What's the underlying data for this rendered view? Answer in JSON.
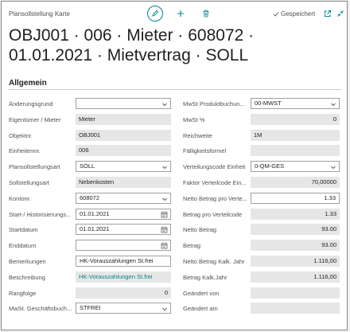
{
  "header": {
    "breadcrumb": "Plansollstellung Karte",
    "saved_label": "Gespeichert",
    "title": "OBJ001 · 006 · Mieter · 608072 · 01.01.2021 · Mietvertrag · SOLL"
  },
  "section": {
    "title": "Allgemein"
  },
  "left_fields": [
    {
      "label": "Änderungsgrund",
      "value": "",
      "type": "select"
    },
    {
      "label": "Eigentümer / Mieter",
      "value": "Mieter",
      "type": "readonly"
    },
    {
      "label": "Objektnr.",
      "value": "OBJ001",
      "type": "readonly"
    },
    {
      "label": "Einheitennr.",
      "value": "006",
      "type": "readonly"
    },
    {
      "label": "Plansollstellungsart",
      "value": "SOLL",
      "type": "select"
    },
    {
      "label": "Sollstellungsart",
      "value": "Nebenkosten",
      "type": "readonly"
    },
    {
      "label": "Kontonr.",
      "value": "608072",
      "type": "select"
    },
    {
      "label": "Start-/ Historisierungs...",
      "value": "01.01.2021",
      "type": "date"
    },
    {
      "label": "Startdatum",
      "value": "01.01.2021",
      "type": "date"
    },
    {
      "label": "Enddatum",
      "value": "",
      "type": "date"
    },
    {
      "label": "Bemerkungen",
      "value": "HK-Vorauszahlungen St.frei",
      "type": "input"
    },
    {
      "label": "Beschreibung",
      "value": "HK-Vorauszahlungen St.frei",
      "type": "readonly-link"
    },
    {
      "label": "Rangfolge",
      "value": "0",
      "type": "readonly-num"
    },
    {
      "label": "MwSt. Geschäftsbuch...",
      "value": "STFREI",
      "type": "select"
    }
  ],
  "right_fields": [
    {
      "label": "MwSt Produktbuchun...",
      "value": "00-MWST",
      "type": "select"
    },
    {
      "label": "MwSt %",
      "value": "0",
      "type": "readonly-num"
    },
    {
      "label": "Reichweite",
      "value": "1M",
      "type": "readonly"
    },
    {
      "label": "Fälligkeitsformel",
      "value": "",
      "type": "readonly"
    },
    {
      "label": "Verteilungscode Einheit",
      "value": "0-QM-GES",
      "type": "select"
    },
    {
      "label": "Faktor Verteilcode Ein...",
      "value": "70,00000",
      "type": "readonly-num"
    },
    {
      "label": "Netto Betrag pro Verte...",
      "value": "1.33",
      "type": "input-num"
    },
    {
      "label": "Betrag pro Verteilcode",
      "value": "1.33",
      "type": "readonly-num"
    },
    {
      "label": "Netto Betrag",
      "value": "93.00",
      "type": "readonly-num"
    },
    {
      "label": "Betrag",
      "value": "93.00",
      "type": "readonly-num"
    },
    {
      "label": "Netto Betrag Kalk. Jahr",
      "value": "1.116,00",
      "type": "readonly-num"
    },
    {
      "label": "Betrag Kalk.Jahr",
      "value": "1.116,00",
      "type": "readonly-num"
    },
    {
      "label": "Geändert von",
      "value": "",
      "type": "readonly"
    },
    {
      "label": "Geändert am",
      "value": "",
      "type": "readonly"
    }
  ]
}
